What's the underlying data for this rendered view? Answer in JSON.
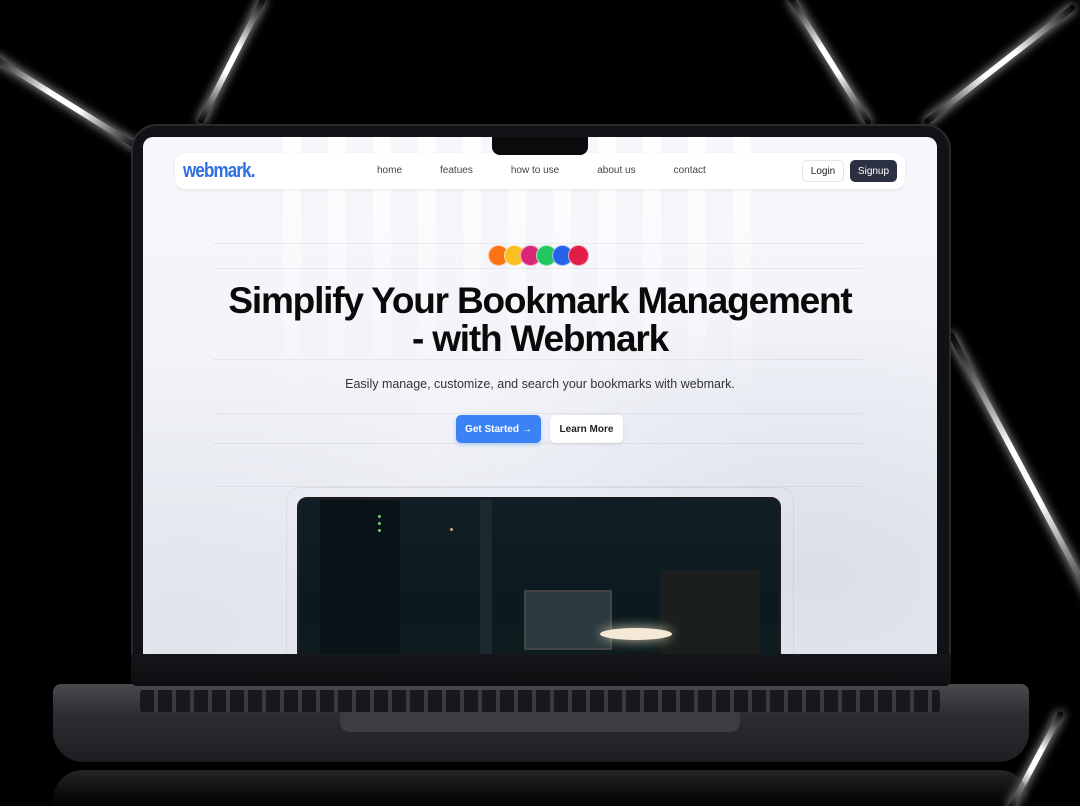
{
  "nav": {
    "logo": "webmark.",
    "links": [
      "home",
      "featues",
      "how to use",
      "about us",
      "contact"
    ],
    "login_label": "Login",
    "signup_label": "Signup"
  },
  "hero": {
    "title_line1": "Simplify Your Bookmark Management",
    "title_line2": "- with Webmark",
    "subtitle": "Easily manage, customize, and search your bookmarks with webmark.",
    "primary_button": "Get Started",
    "primary_button_icon": "→",
    "secondary_button": "Learn More",
    "dot_colors": [
      "#f97316",
      "#fbbf24",
      "#db2777",
      "#22c55e",
      "#2563eb",
      "#e11d48"
    ]
  },
  "colors": {
    "brand": "#2f6fe4",
    "primary": "#3b82f6",
    "signup_bg": "#2b3140"
  }
}
